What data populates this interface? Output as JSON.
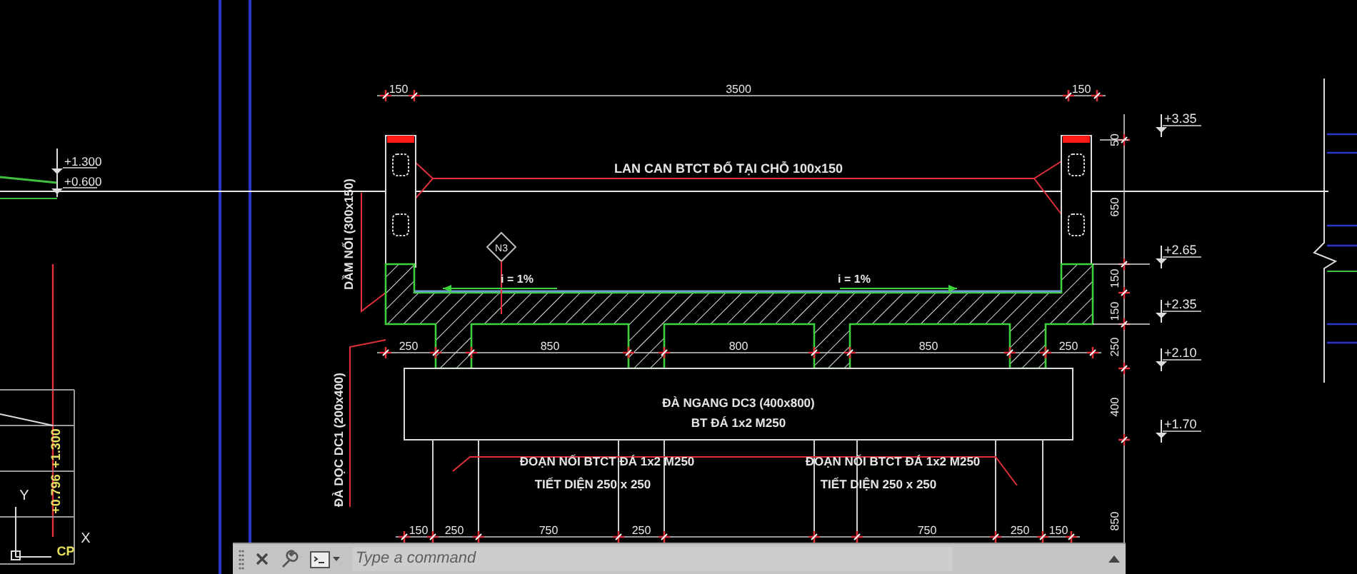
{
  "left_elevations": [
    "+1.300",
    "+0.600"
  ],
  "left_table": {
    "values": [
      "+1.300",
      "+0.796"
    ],
    "code": "CP"
  },
  "axis_labels": {
    "y": "Y",
    "x": "X"
  },
  "side_labels": [
    "DẦM NỐI (300x150)",
    "ĐÀ DỌC DC1 (200x400)"
  ],
  "top_dimensions": [
    "150",
    "3500",
    "150"
  ],
  "railing_label": "LAN CAN BTCT ĐỔ TẠI CHỖ 100x150",
  "section_tag": "N3",
  "slopes": [
    "i = 1%",
    "i = 1%"
  ],
  "beam_dimensions": [
    "250",
    "850",
    "800",
    "850",
    "250"
  ],
  "cross_beam": {
    "lines": [
      "ĐÀ NGANG DC3 (400x800)",
      "BT ĐÁ 1x2 M250"
    ]
  },
  "connectors": [
    {
      "title": "ĐOẠN NỐI BTCT ĐÁ 1x2 M250",
      "section": "TIẾT DIỆN 250 x 250"
    },
    {
      "title": "ĐOẠN NỐI BTCT ĐÁ 1x2 M250",
      "section": "TIẾT DIỆN 250 x 250"
    }
  ],
  "bottom_dimensions": [
    "150",
    "250",
    "750",
    "250",
    "750",
    "250",
    "150"
  ],
  "vertical_dimensions": [
    "50",
    "650",
    "150",
    "150",
    "250",
    "400",
    "850"
  ],
  "elevations": [
    "+3.35",
    "+2.65",
    "+2.35",
    "+2.10",
    "+1.70"
  ],
  "command_line": {
    "placeholder": "Type a command"
  }
}
